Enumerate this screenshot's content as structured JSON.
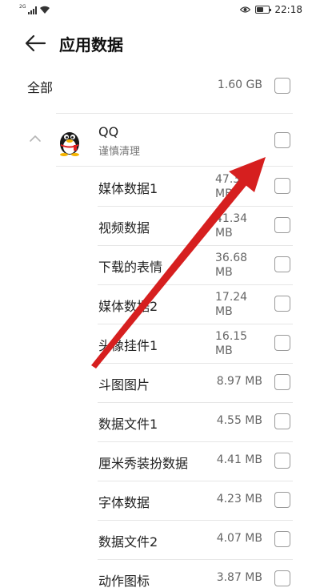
{
  "status_bar": {
    "network": "2G",
    "time": "22:18",
    "battery_level": 0.55
  },
  "header": {
    "back_icon": "arrow-left-icon",
    "title": "应用数据"
  },
  "summary": {
    "label": "全部",
    "size": "1.60 GB"
  },
  "app": {
    "expand_icon": "chevron-up-icon",
    "avatar_icon": "qq-penguin-icon",
    "name": "QQ",
    "subtitle": "谨慎清理"
  },
  "items": [
    {
      "label": "媒体数据1",
      "size": "47.37 MB"
    },
    {
      "label": "视频数据",
      "size": "41.34 MB"
    },
    {
      "label": "下载的表情",
      "size": "36.68 MB"
    },
    {
      "label": "媒体数据2",
      "size": "17.24 MB"
    },
    {
      "label": "头像挂件1",
      "size": "16.15 MB"
    },
    {
      "label": "斗图图片",
      "size": "8.97 MB"
    },
    {
      "label": "数据文件1",
      "size": "4.55 MB"
    },
    {
      "label": "厘米秀装扮数据",
      "size": "4.41 MB"
    },
    {
      "label": "字体数据",
      "size": "4.23 MB"
    },
    {
      "label": "数据文件2",
      "size": "4.07 MB"
    },
    {
      "label": "动作图标",
      "size": "3.87 MB"
    }
  ],
  "colors": {
    "annotation_arrow": "#d61f1f",
    "divider": "#e6e6e6",
    "checkbox_border": "#9a9a9a"
  }
}
